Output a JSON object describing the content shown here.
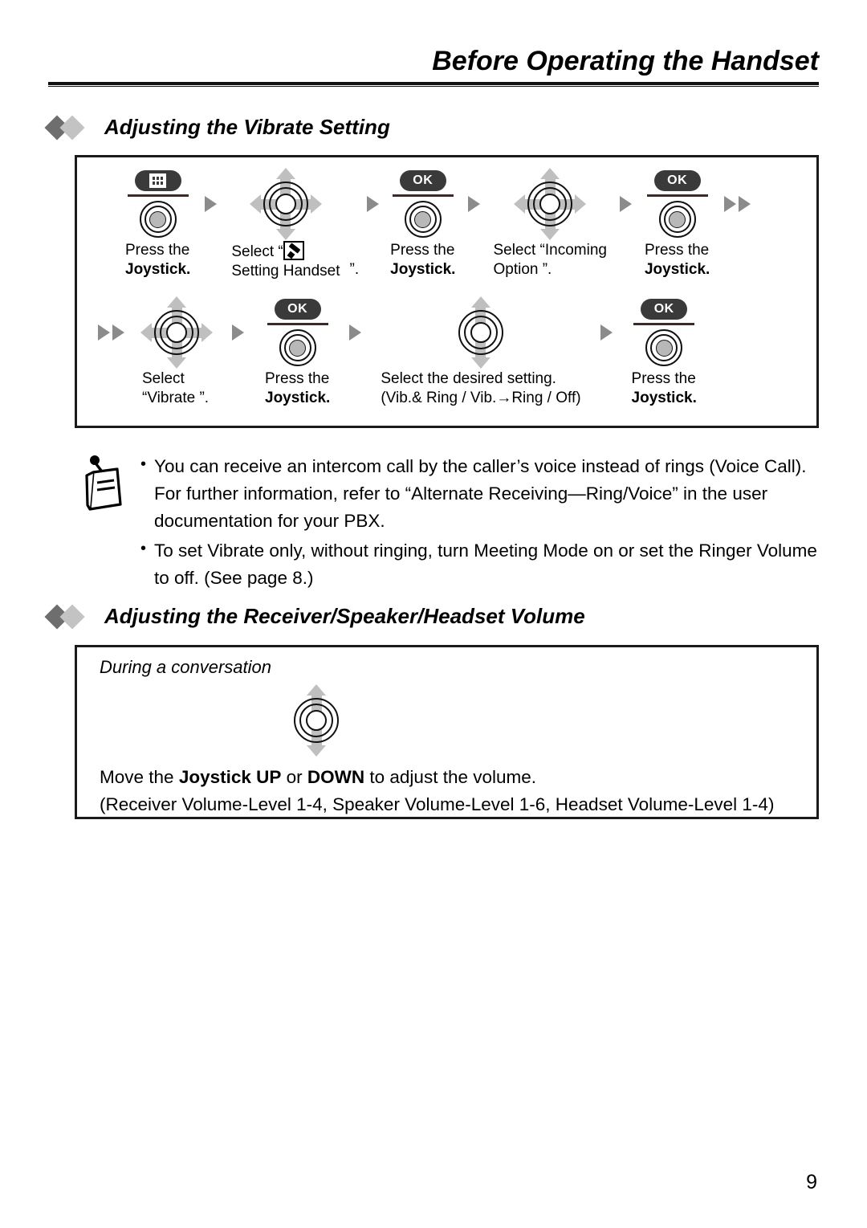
{
  "header": {
    "title": "Before Operating the Handset"
  },
  "sections": [
    {
      "heading": "Adjusting the Vibrate Setting"
    },
    {
      "heading": "Adjusting the Receiver/Speaker/Headset Volume"
    }
  ],
  "vibrate_flow": {
    "rows": [
      {
        "steps": [
          {
            "art": "menu-key",
            "key_label": "",
            "key_icon": "menu-grid-icon",
            "caption_line1": "Press the",
            "caption_line2": "Joystick.",
            "caption_line2_bold": true
          },
          {
            "art": "joystick-4way",
            "caption_line1": "Select “",
            "caption_line1_icon": "pencil-icon",
            "caption_line2": "Setting Handset",
            "caption_trail": "”."
          },
          {
            "art": "ok-key",
            "key_label": "OK",
            "caption_line1": "Press the",
            "caption_line2": "Joystick.",
            "caption_line2_bold": true
          },
          {
            "art": "joystick-4way",
            "caption_line1": "Select “Incoming",
            "caption_line2": "Option  ”."
          },
          {
            "art": "ok-key",
            "key_label": "OK",
            "caption_line1": "Press the",
            "caption_line2": "Joystick.",
            "caption_line2_bold": true
          }
        ]
      },
      {
        "steps": [
          {
            "art": "joystick-4way",
            "caption_line1": "Select",
            "caption_line2": "“Vibrate  ”."
          },
          {
            "art": "ok-key",
            "key_label": "OK",
            "caption_line1": "Press the",
            "caption_line2": "Joystick.",
            "caption_line2_bold": true
          },
          {
            "art": "joystick-updown",
            "caption_line1": "Select the desired setting.",
            "caption_line2": "(Vib.& Ring / Vib.→Ring / Off)"
          },
          {
            "art": "ok-key",
            "key_label": "OK",
            "caption_line1": "Press the",
            "caption_line2": "Joystick.",
            "caption_line2_bold": true
          }
        ]
      }
    ]
  },
  "note": {
    "icon": "notepad-icon",
    "bullets": [
      "You can receive an intercom call by the caller’s voice instead of rings (Voice Call). For further information, refer to “Alternate Receiving—Ring/Voice” in the user documentation for your PBX.",
      "To set Vibrate only, without ringing, turn Meeting Mode on or set the Ringer Volume to off. (See page 8.)"
    ]
  },
  "volume": {
    "subtitle": "During a conversation",
    "art": "joystick-updown",
    "instruction": {
      "pre": "Move the ",
      "bold1": "Joystick UP",
      "mid": " or ",
      "bold2": "DOWN",
      "post": " to adjust the volume."
    },
    "levels": "(Receiver Volume-Level 1-4, Speaker Volume-Level 1-6, Headset Volume-Level 1-4)"
  },
  "footer": {
    "page_number": "9"
  },
  "colors": {
    "key_dark": "#3a3a3a",
    "arrow_gray": "#8b8b8b",
    "nav_arrow_gray": "#bfbfbf",
    "diamond_dark": "#6e6e6e",
    "diamond_light": "#c3c3c3",
    "rule": "#111111"
  }
}
